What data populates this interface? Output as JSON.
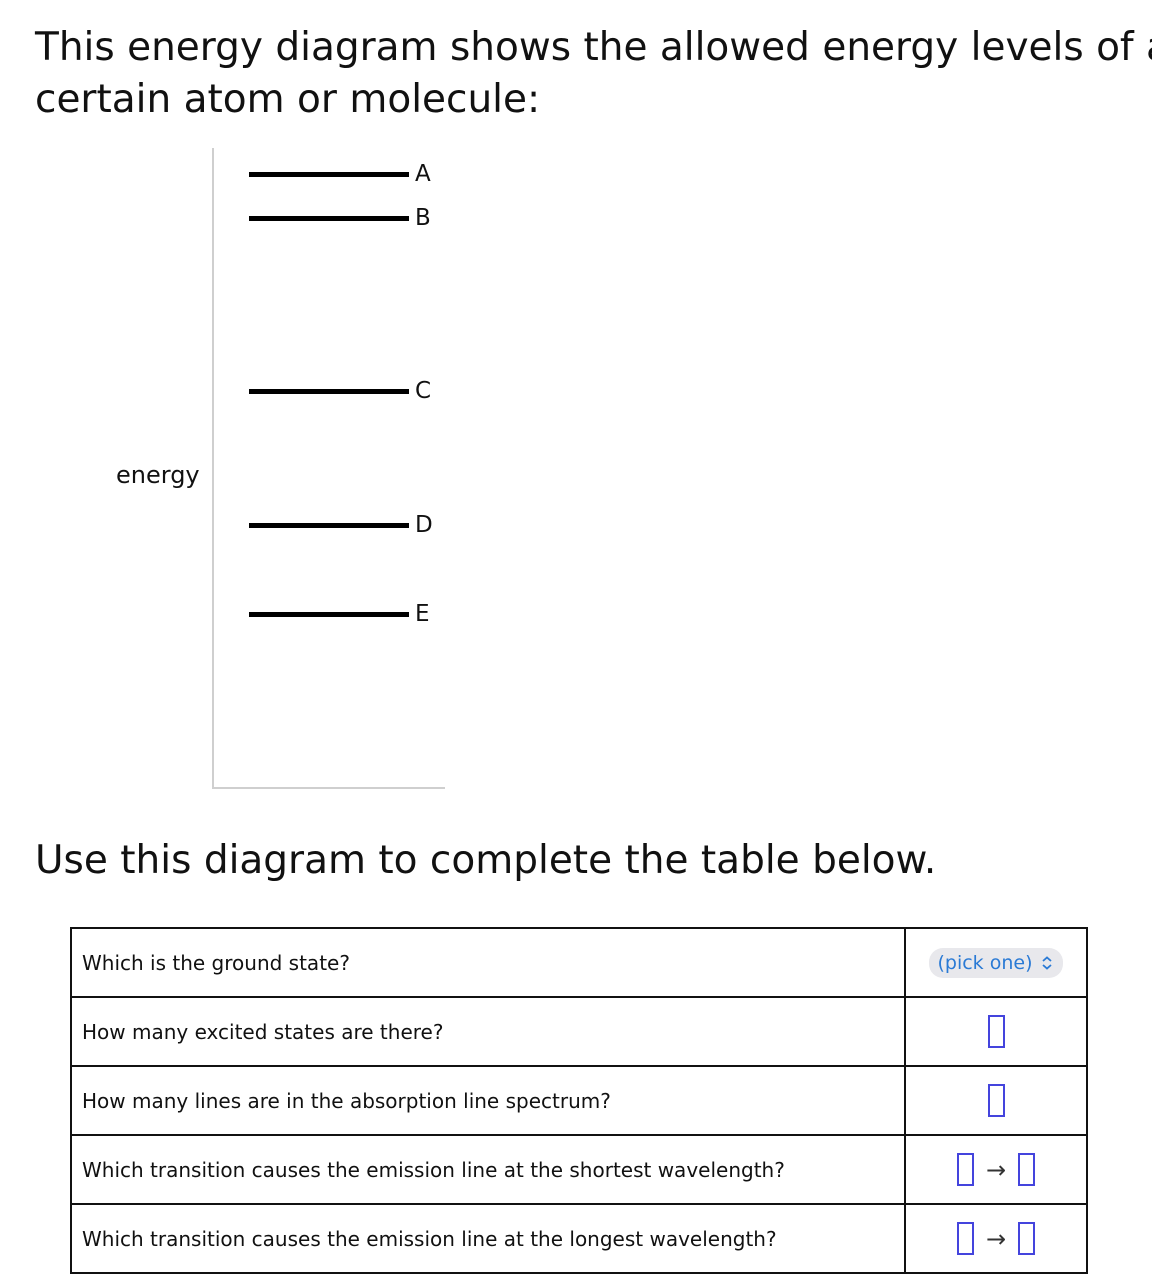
{
  "intro_text": "This energy diagram shows the allowed energy levels of a certain atom or molecule:",
  "intro_line1": "This energy diagram shows the allowed energy levels of a",
  "intro_line2": "certain atom or molecule:",
  "diagram": {
    "axis_label": "energy",
    "levels": [
      {
        "label": "A",
        "relative_energy": 0.96
      },
      {
        "label": "B",
        "relative_energy": 0.89
      },
      {
        "label": "C",
        "relative_energy": 0.62
      },
      {
        "label": "D",
        "relative_energy": 0.41
      },
      {
        "label": "E",
        "relative_energy": 0.27
      }
    ]
  },
  "instruction": "Use this diagram to complete the table below.",
  "table": {
    "rows": [
      {
        "question": "Which is the ground state?",
        "answer_type": "select",
        "select_value": "(pick one)"
      },
      {
        "question": "How many excited states are there?",
        "answer_type": "input"
      },
      {
        "question": "How many lines are in the absorption line spectrum?",
        "answer_type": "input"
      },
      {
        "question": "Which transition causes the emission line at the shortest wavelength?",
        "answer_type": "transition",
        "arrow": "→"
      },
      {
        "question": "Which transition causes the emission line at the longest wavelength?",
        "answer_type": "transition",
        "arrow": "→"
      }
    ]
  },
  "colors": {
    "select_text": "#2a7ad5",
    "input_border": "#4444dd"
  }
}
